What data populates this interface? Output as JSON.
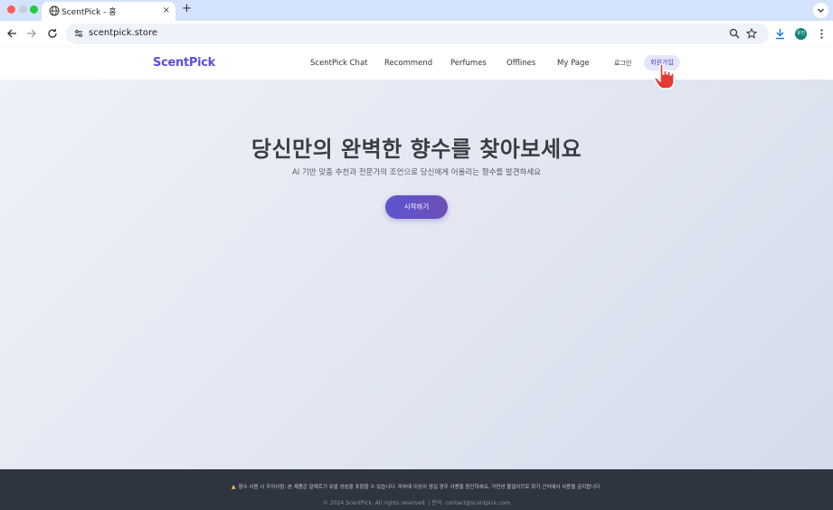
{
  "browser": {
    "tab_title": "ScentPick - 홈",
    "tab_close": "×",
    "new_tab": "+",
    "url": "scentpick.store",
    "avatar_text": "유진"
  },
  "site": {
    "brand": "ScentPick",
    "nav": {
      "chat": "ScentPick Chat",
      "recommend": "Recommend",
      "perfumes": "Perfumes",
      "offlines": "Offlines",
      "mypage": "My Page",
      "login": "로그인",
      "signup": "회원가입"
    }
  },
  "hero": {
    "title": "당신만의 완벽한 향수를 찾아보세요",
    "subtitle": "AI 기반 맞춤 추천과 전문가의 조언으로 당신에게 어울리는 향수를 발견하세요",
    "cta": "시작하기"
  },
  "footer": {
    "warning": "향수 사용 시 주의사항: 본 제품은 알레르기 유발 성분을 포함할 수 있습니다. 피부에 이상이 생길 경우 사용을 중단하세요. 가연성 물질이므로 화기 근처에서 사용을 금지합니다.",
    "copyright": "© 2024 ScentPick. All rights reserved. | 문의: contact@scentpick.com"
  },
  "colors": {
    "brand": "#5b4fd6",
    "cta_start": "#5d55d0",
    "cta_end": "#6c4fb5",
    "footer_bg": "#2e3440",
    "tabstrip": "#d3e3fd"
  }
}
